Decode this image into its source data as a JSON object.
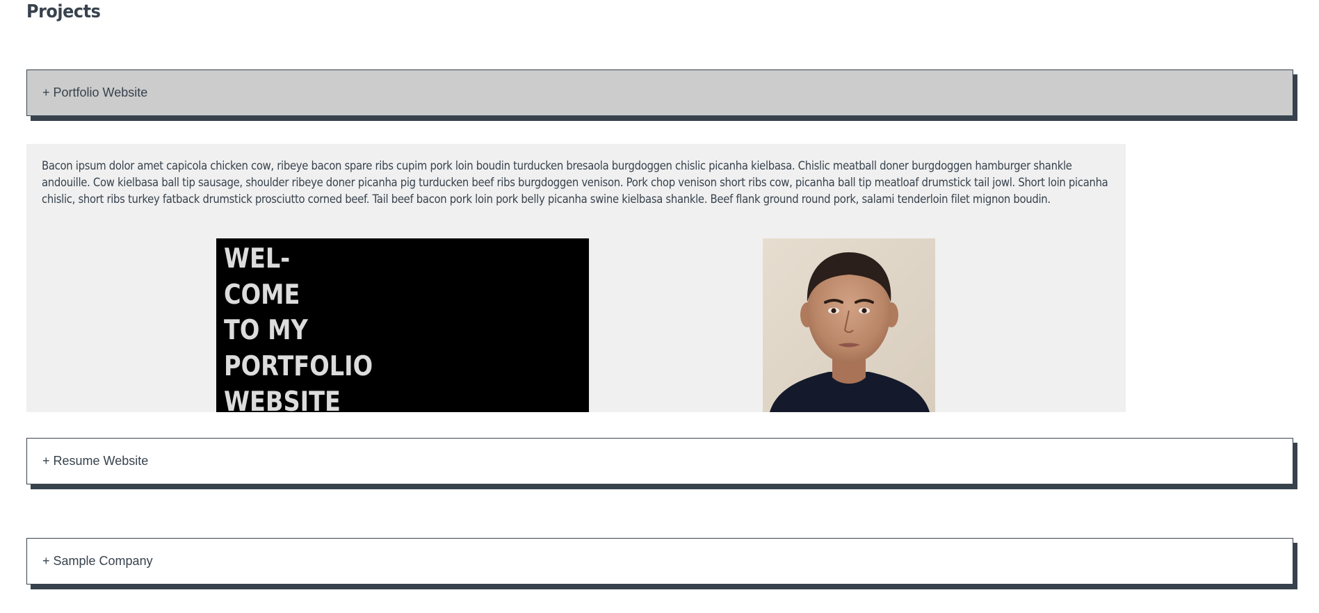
{
  "page": {
    "title": "Projects"
  },
  "accordions": [
    {
      "label": "+ Portfolio Website",
      "expanded": true
    },
    {
      "label": "+ Resume Website",
      "expanded": false
    },
    {
      "label": "+ Sample Company",
      "expanded": false
    }
  ],
  "panel": {
    "description": "Bacon ipsum dolor amet capicola chicken cow, ribeye bacon spare ribs cupim pork loin boudin turducken bresaola burgdoggen chislic picanha kielbasa. Chislic meatball doner burgdoggen hamburger shankle andouille. Cow kielbasa ball tip sausage, shoulder ribeye doner picanha pig turducken beef ribs burgdoggen venison. Pork chop venison short ribs cow, picanha ball tip meatloaf drumstick tail jowl. Short loin picanha chislic, short ribs turkey fatback drumstick prosciutto corned beef. Tail beef bacon pork loin pork belly picanha swine kielbasa shankle. Beef flank ground round pork, salami tenderloin filet mignon boudin.",
    "welcome_image_lines": [
      "WEL-",
      "COME",
      "TO MY",
      "PORTFOLIO",
      "WEBSITE"
    ],
    "portrait_image": "portrait-photo"
  },
  "colors": {
    "text": "#37424d",
    "active_accordion_bg": "#cccccc",
    "panel_bg": "#f0f0f0",
    "shadow": "#37424d"
  }
}
